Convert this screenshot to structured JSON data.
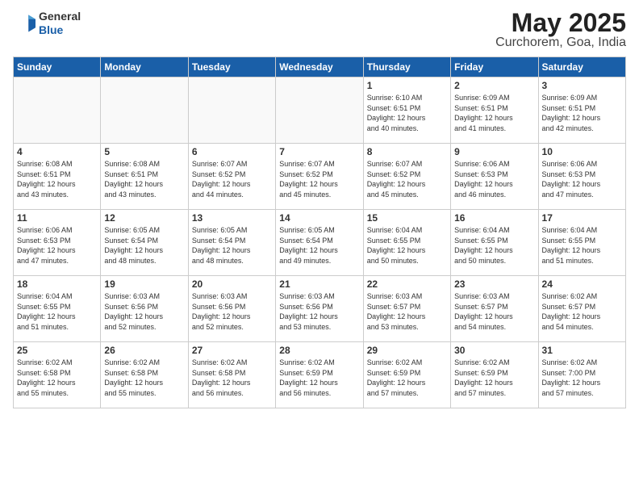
{
  "header": {
    "logo_general": "General",
    "logo_blue": "Blue",
    "title": "May 2025",
    "subtitle": "Curchorem, Goa, India"
  },
  "weekdays": [
    "Sunday",
    "Monday",
    "Tuesday",
    "Wednesday",
    "Thursday",
    "Friday",
    "Saturday"
  ],
  "weeks": [
    [
      {
        "day": "",
        "info": ""
      },
      {
        "day": "",
        "info": ""
      },
      {
        "day": "",
        "info": ""
      },
      {
        "day": "",
        "info": ""
      },
      {
        "day": "1",
        "info": "Sunrise: 6:10 AM\nSunset: 6:51 PM\nDaylight: 12 hours\nand 40 minutes."
      },
      {
        "day": "2",
        "info": "Sunrise: 6:09 AM\nSunset: 6:51 PM\nDaylight: 12 hours\nand 41 minutes."
      },
      {
        "day": "3",
        "info": "Sunrise: 6:09 AM\nSunset: 6:51 PM\nDaylight: 12 hours\nand 42 minutes."
      }
    ],
    [
      {
        "day": "4",
        "info": "Sunrise: 6:08 AM\nSunset: 6:51 PM\nDaylight: 12 hours\nand 43 minutes."
      },
      {
        "day": "5",
        "info": "Sunrise: 6:08 AM\nSunset: 6:51 PM\nDaylight: 12 hours\nand 43 minutes."
      },
      {
        "day": "6",
        "info": "Sunrise: 6:07 AM\nSunset: 6:52 PM\nDaylight: 12 hours\nand 44 minutes."
      },
      {
        "day": "7",
        "info": "Sunrise: 6:07 AM\nSunset: 6:52 PM\nDaylight: 12 hours\nand 45 minutes."
      },
      {
        "day": "8",
        "info": "Sunrise: 6:07 AM\nSunset: 6:52 PM\nDaylight: 12 hours\nand 45 minutes."
      },
      {
        "day": "9",
        "info": "Sunrise: 6:06 AM\nSunset: 6:53 PM\nDaylight: 12 hours\nand 46 minutes."
      },
      {
        "day": "10",
        "info": "Sunrise: 6:06 AM\nSunset: 6:53 PM\nDaylight: 12 hours\nand 47 minutes."
      }
    ],
    [
      {
        "day": "11",
        "info": "Sunrise: 6:06 AM\nSunset: 6:53 PM\nDaylight: 12 hours\nand 47 minutes."
      },
      {
        "day": "12",
        "info": "Sunrise: 6:05 AM\nSunset: 6:54 PM\nDaylight: 12 hours\nand 48 minutes."
      },
      {
        "day": "13",
        "info": "Sunrise: 6:05 AM\nSunset: 6:54 PM\nDaylight: 12 hours\nand 48 minutes."
      },
      {
        "day": "14",
        "info": "Sunrise: 6:05 AM\nSunset: 6:54 PM\nDaylight: 12 hours\nand 49 minutes."
      },
      {
        "day": "15",
        "info": "Sunrise: 6:04 AM\nSunset: 6:55 PM\nDaylight: 12 hours\nand 50 minutes."
      },
      {
        "day": "16",
        "info": "Sunrise: 6:04 AM\nSunset: 6:55 PM\nDaylight: 12 hours\nand 50 minutes."
      },
      {
        "day": "17",
        "info": "Sunrise: 6:04 AM\nSunset: 6:55 PM\nDaylight: 12 hours\nand 51 minutes."
      }
    ],
    [
      {
        "day": "18",
        "info": "Sunrise: 6:04 AM\nSunset: 6:55 PM\nDaylight: 12 hours\nand 51 minutes."
      },
      {
        "day": "19",
        "info": "Sunrise: 6:03 AM\nSunset: 6:56 PM\nDaylight: 12 hours\nand 52 minutes."
      },
      {
        "day": "20",
        "info": "Sunrise: 6:03 AM\nSunset: 6:56 PM\nDaylight: 12 hours\nand 52 minutes."
      },
      {
        "day": "21",
        "info": "Sunrise: 6:03 AM\nSunset: 6:56 PM\nDaylight: 12 hours\nand 53 minutes."
      },
      {
        "day": "22",
        "info": "Sunrise: 6:03 AM\nSunset: 6:57 PM\nDaylight: 12 hours\nand 53 minutes."
      },
      {
        "day": "23",
        "info": "Sunrise: 6:03 AM\nSunset: 6:57 PM\nDaylight: 12 hours\nand 54 minutes."
      },
      {
        "day": "24",
        "info": "Sunrise: 6:02 AM\nSunset: 6:57 PM\nDaylight: 12 hours\nand 54 minutes."
      }
    ],
    [
      {
        "day": "25",
        "info": "Sunrise: 6:02 AM\nSunset: 6:58 PM\nDaylight: 12 hours\nand 55 minutes."
      },
      {
        "day": "26",
        "info": "Sunrise: 6:02 AM\nSunset: 6:58 PM\nDaylight: 12 hours\nand 55 minutes."
      },
      {
        "day": "27",
        "info": "Sunrise: 6:02 AM\nSunset: 6:58 PM\nDaylight: 12 hours\nand 56 minutes."
      },
      {
        "day": "28",
        "info": "Sunrise: 6:02 AM\nSunset: 6:59 PM\nDaylight: 12 hours\nand 56 minutes."
      },
      {
        "day": "29",
        "info": "Sunrise: 6:02 AM\nSunset: 6:59 PM\nDaylight: 12 hours\nand 57 minutes."
      },
      {
        "day": "30",
        "info": "Sunrise: 6:02 AM\nSunset: 6:59 PM\nDaylight: 12 hours\nand 57 minutes."
      },
      {
        "day": "31",
        "info": "Sunrise: 6:02 AM\nSunset: 7:00 PM\nDaylight: 12 hours\nand 57 minutes."
      }
    ]
  ]
}
